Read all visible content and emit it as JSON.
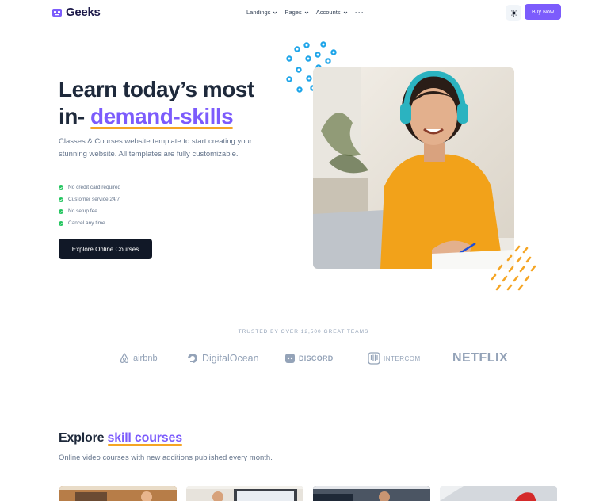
{
  "brand": {
    "name": "Geeks"
  },
  "nav": {
    "items": [
      {
        "label": "Landings"
      },
      {
        "label": "Pages"
      },
      {
        "label": "Accounts"
      }
    ],
    "more_label": "···",
    "buy_label": "Buy Now"
  },
  "hero": {
    "title_line1": "Learn today’s most",
    "title_prefix": "in- ",
    "title_highlight": "demand-skills",
    "subtitle": "Classes & Courses website template to start creating your stunning website. All templates are fully customizable.",
    "features": [
      "No credit card required",
      "Customer service 24/7",
      "No setup fee",
      "Cancel any time"
    ],
    "cta_label": "Explore Online Courses"
  },
  "trusted": {
    "heading": "TRUSTED BY OVER 12,500 GREAT TEAMS",
    "logos": [
      "airbnb",
      "DigitalOcean",
      "DISCORD",
      "INTERCOM",
      "NETFLIX"
    ]
  },
  "explore": {
    "title_prefix": "Explore ",
    "title_highlight": "skill courses",
    "subtitle": "Online video courses with new additions published every month."
  },
  "colors": {
    "accent": "#7c5cfc",
    "underline": "#f5a524",
    "dark": "#111827",
    "check": "#22c55e",
    "dots_blue": "#1ea5e9",
    "dots_orange": "#f5a524"
  }
}
